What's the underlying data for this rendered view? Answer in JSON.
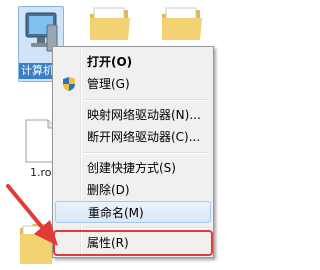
{
  "desktop": {
    "computer_label": "计算机",
    "file_label": "1.ro"
  },
  "context_menu": {
    "items": [
      {
        "label": "打开(O)",
        "bold": true
      },
      {
        "label": "管理(G)",
        "icon": "shield-icon"
      },
      {
        "label": "映射网络驱动器(N)..."
      },
      {
        "label": "断开网络驱动器(C)..."
      },
      {
        "label": "创建快捷方式(S)"
      },
      {
        "label": "删除(D)"
      },
      {
        "label": "重命名(M)"
      },
      {
        "label": "属性(R)"
      }
    ]
  },
  "colors": {
    "selection": "#3b7fc8",
    "annotation_red": "#e23a3a",
    "folder": "#f3d274"
  }
}
